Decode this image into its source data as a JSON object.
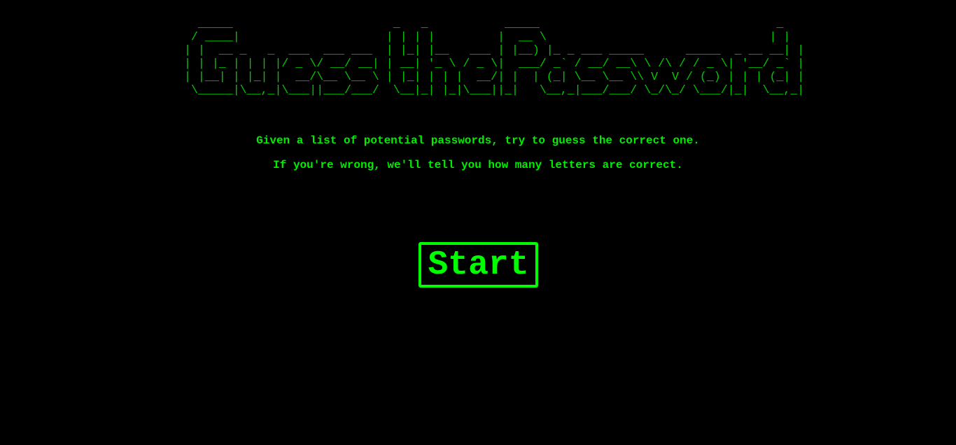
{
  "game": {
    "title_ascii": "  _____                       _   _           _____                                  _ \n / ____|                     | | | |         |  __ \\                                | |\n| |  __ _   _  ___  ___ ___  | |_| |__   ___ | |__) |_ _ ___ _____      _____  _ __ __| |\n| | |_ | | | |/ _ \\/ __/ __| | __| '_ \\ / _ \\|  ___/ _` / __/ __\\ \\ /\\ / / _ \\| '__/ _` |\n| |__| | |_| |  __/\\__ \\__ \\ | |_| | | |  __/| |  | (_| \\__ \\__ \\\\ V  V / (_) | | | (_| |\n \\_____|\\__,_|\\___||___/___/  \\__|_| |_|\\___||_|   \\__,_|___/___/ \\_/\\_/ \\___/|_|  \\__,_|",
    "intro_line1": "Given a list of potential passwords, try to guess the correct one.",
    "intro_line2": "If you're wrong, we'll tell you how many letters are correct.",
    "start_label": "Start"
  },
  "colors": {
    "background": "#000000",
    "text": "#00ee00",
    "button": "#00ff00"
  }
}
